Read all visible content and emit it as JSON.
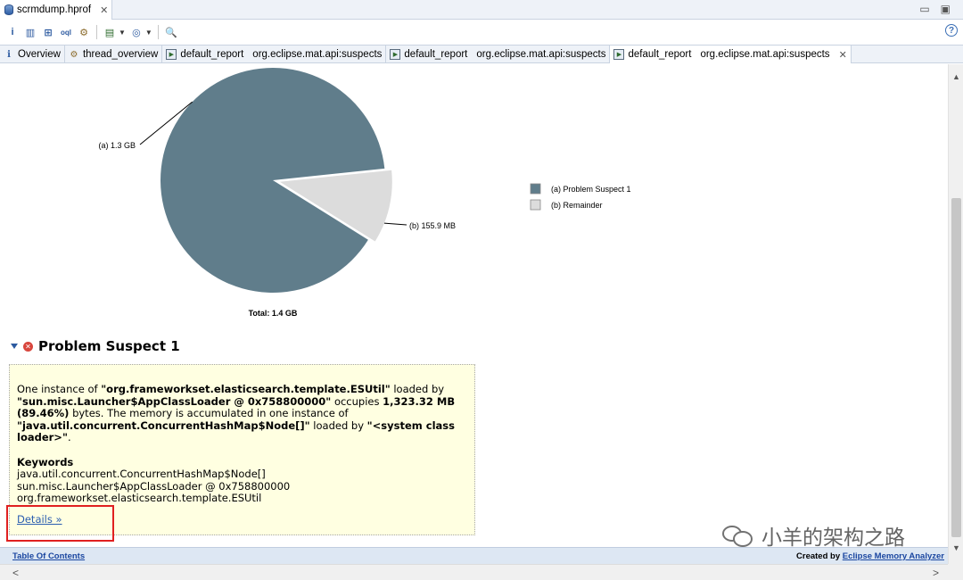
{
  "editor_tab": {
    "title": "scrmdump.hprof",
    "close": "✕"
  },
  "window_controls": {
    "minimize": "▭",
    "maximize": "▣"
  },
  "toolbar": {
    "info": "i",
    "histogram": "▥",
    "dominator": "⊞",
    "query": "oql",
    "thread": "⚙",
    "report": "▤",
    "heap_dump": "◎",
    "search": "🔍",
    "help": "?"
  },
  "report_tabs": [
    {
      "label": "Overview",
      "icon": "i"
    },
    {
      "label": "thread_overview",
      "icon": "⚙"
    },
    {
      "label": "default_report",
      "sub": "org.eclipse.mat.api:suspects"
    },
    {
      "label": "default_report",
      "sub": "org.eclipse.mat.api:suspects"
    },
    {
      "label": "default_report",
      "sub": "org.eclipse.mat.api:suspects",
      "close": "✕"
    }
  ],
  "chart_data": {
    "type": "pie",
    "slices": [
      {
        "label": "(a)",
        "name": "Problem Suspect 1",
        "value_label": "1.3 GB",
        "value_mb": 1323.32,
        "color": "#607d8b"
      },
      {
        "label": "(b)",
        "name": "Remainder",
        "value_label": "155.9 MB",
        "value_mb": 155.9,
        "color": "#dcdcdc"
      }
    ],
    "total_label": "Total: 1.4 GB",
    "legend": [
      "(a)  Problem Suspect 1",
      "(b)  Remainder"
    ],
    "legend_position": "right"
  },
  "suspect": {
    "title": "Problem Suspect 1",
    "desc_p1": "One instance of ",
    "class_name": "\"org.frameworkset.elasticsearch.template.ESUtil\"",
    "desc_p2": " loaded by ",
    "loader": "\"sun.misc.Launcher$AppClassLoader @ 0x758800000\"",
    "desc_p3": " occupies ",
    "size": "1,323.32 MB (89.46%)",
    "desc_p4": " bytes. The memory is accumulated in one instance of ",
    "acc_class": "\"java.util.concurrent.ConcurrentHashMap$Node[]\"",
    "desc_p5": " loaded by ",
    "acc_loader": "\"<system class loader>\"",
    "desc_p6": ".",
    "keywords_title": "Keywords",
    "keywords": [
      "java.util.concurrent.ConcurrentHashMap$Node[]",
      "sun.misc.Launcher$AppClassLoader @ 0x758800000",
      "org.frameworkset.elasticsearch.template.ESUtil"
    ],
    "details_link": "Details »"
  },
  "footer": {
    "toc": "Table Of Contents",
    "created_by": "Created by ",
    "tool_link": "Eclipse Memory Analyzer"
  },
  "watermark": {
    "text": "小羊的架构之路"
  }
}
